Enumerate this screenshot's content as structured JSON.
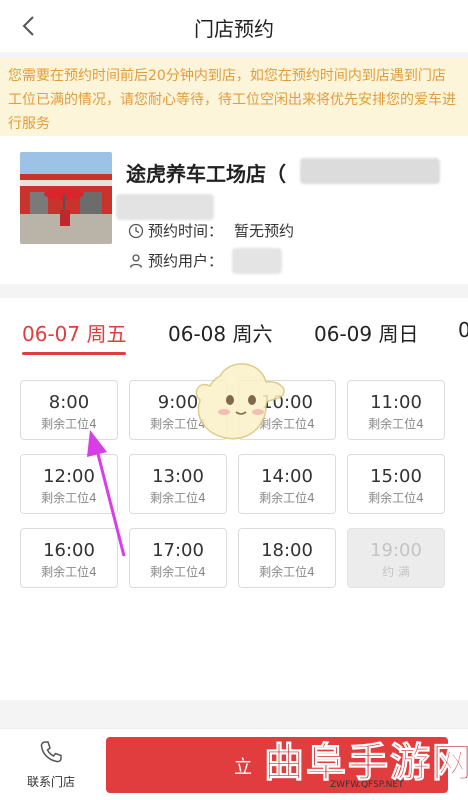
{
  "header": {
    "title": "门店预约"
  },
  "notice": {
    "text": "您需要在预约时间前后20分钟内到店，如您在预约时间内到店遇到门店工位已满的情况，请您耐心等待，待工位空闲出来将优先安排您的爱车进行服务"
  },
  "store": {
    "name": "途虎养车工场店（",
    "time_label": "预约时间：",
    "time_value": "暂无预约",
    "user_label": "预约用户："
  },
  "tabs": [
    "06-07 周五",
    "06-08 周六",
    "06-09 周日"
  ],
  "slots": [
    {
      "time": "8:00",
      "remain": "剩余工位4"
    },
    {
      "time": "9:00",
      "remain": "剩余工位4"
    },
    {
      "time": "10:00",
      "remain": "剩余工位4"
    },
    {
      "time": "11:00",
      "remain": "剩余工位4"
    },
    {
      "time": "12:00",
      "remain": "剩余工位4"
    },
    {
      "time": "13:00",
      "remain": "剩余工位4"
    },
    {
      "time": "14:00",
      "remain": "剩余工位4"
    },
    {
      "time": "15:00",
      "remain": "剩余工位4"
    },
    {
      "time": "16:00",
      "remain": "剩余工位4"
    },
    {
      "time": "17:00",
      "remain": "剩余工位4"
    },
    {
      "time": "18:00",
      "remain": "剩余工位4"
    },
    {
      "time": "19:00",
      "remain": "约 满"
    }
  ],
  "bottom": {
    "contact_label": "联系门店",
    "reserve_label": "立"
  },
  "watermark": {
    "text": "曲阜手游网",
    "url": "ZWFW.QFSP.NET"
  },
  "colors": {
    "accent": "#e23d3e",
    "notice_bg": "#fdf5d9",
    "notice_text": "#e29c3b"
  }
}
